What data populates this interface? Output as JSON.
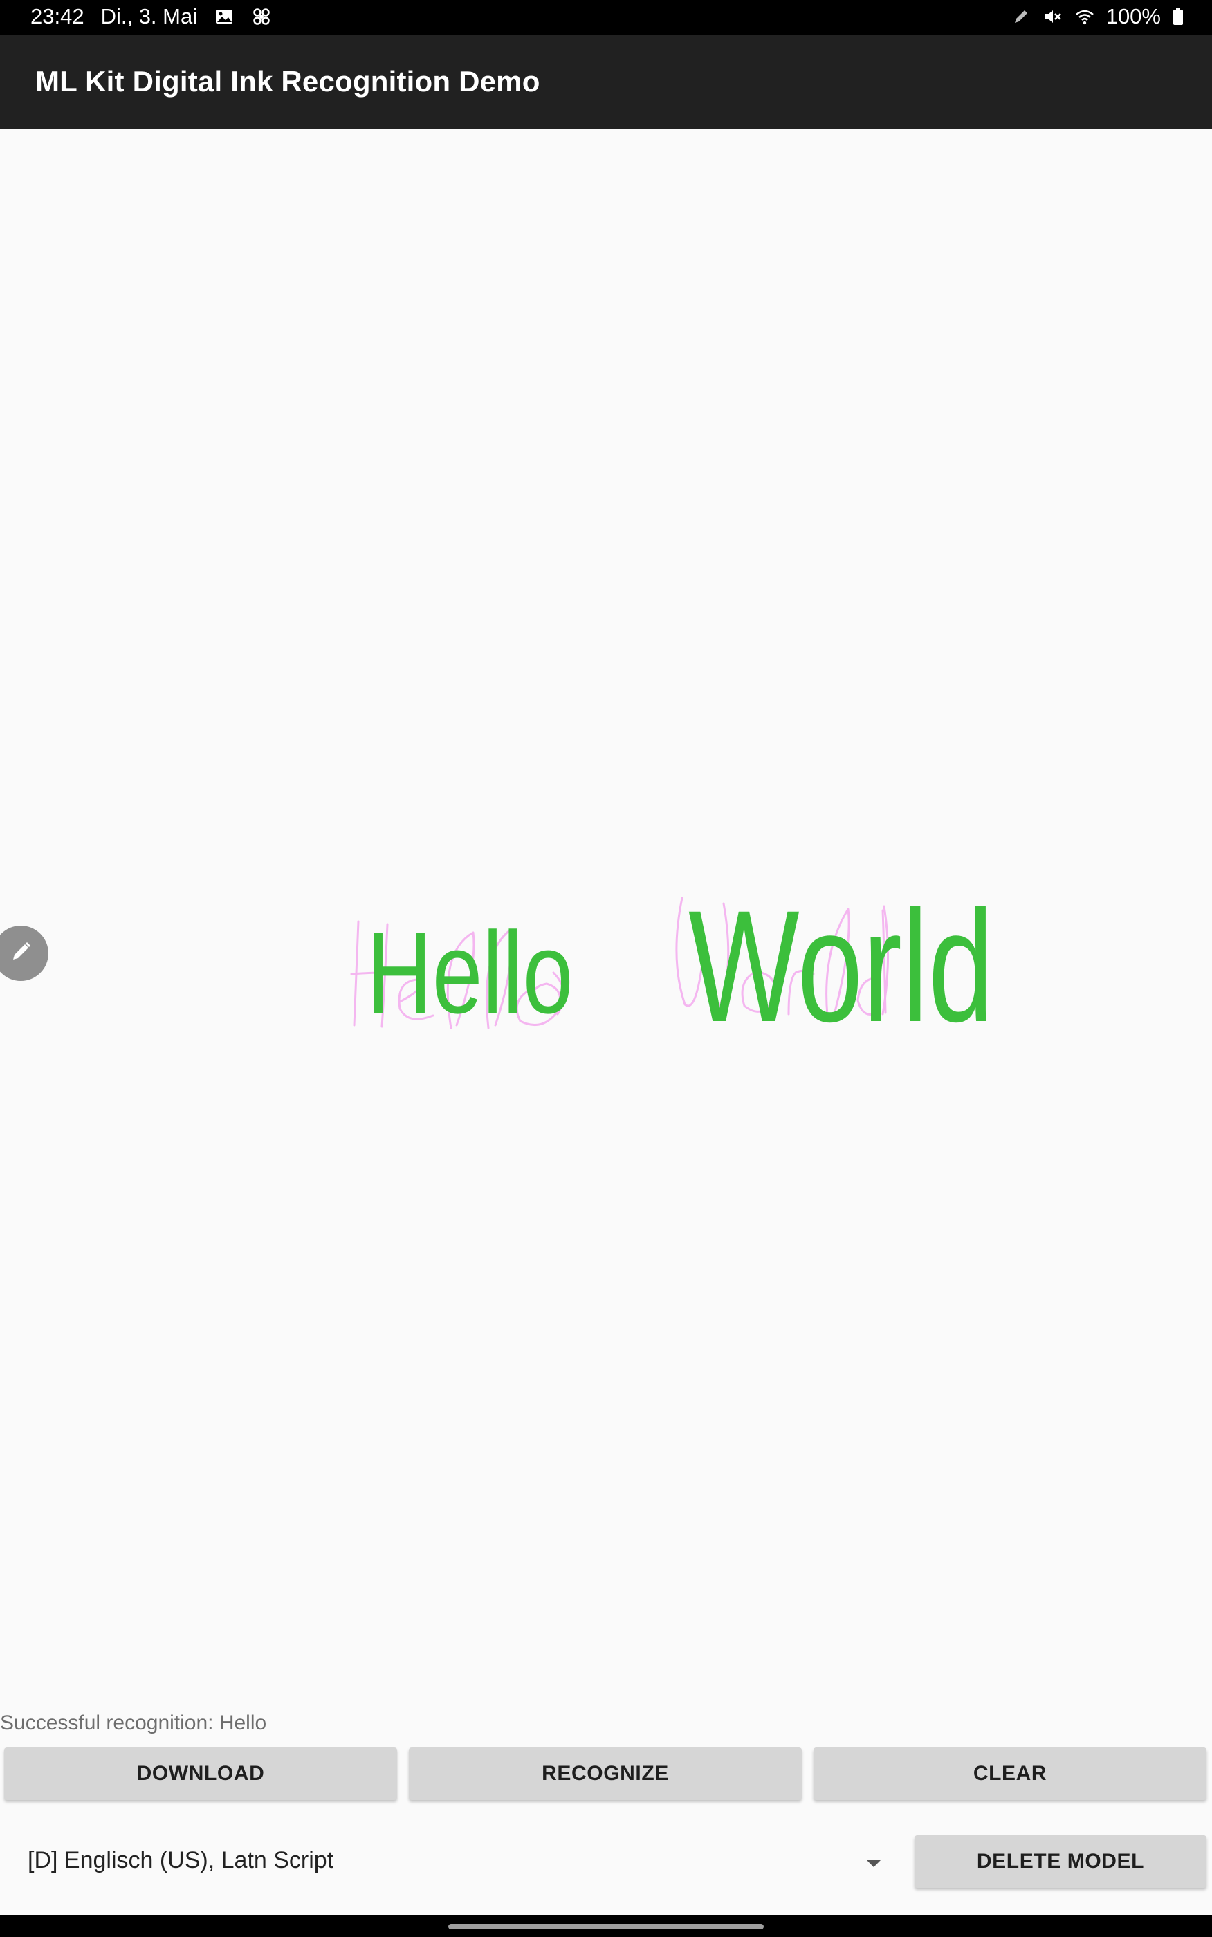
{
  "status_bar": {
    "time": "23:42",
    "date": "Di., 3. Mai",
    "left_icons": [
      "gallery-icon",
      "fan-icon"
    ],
    "right_icons": [
      "pen-icon",
      "mute-icon",
      "wifi-icon"
    ],
    "battery": "100%"
  },
  "app_bar": {
    "title": "ML Kit Digital Ink Recognition Demo"
  },
  "canvas": {
    "recognized_words": [
      "Hello",
      "World"
    ],
    "ink_color": "#f4b6f0",
    "text_color": "#3cbf3c",
    "fab_icon": "pencil-icon"
  },
  "status_text": "Successful recognition: Hello",
  "buttons": {
    "download": "DOWNLOAD",
    "recognize": "RECOGNIZE",
    "clear": "CLEAR",
    "delete_model": "DELETE MODEL"
  },
  "language_spinner": {
    "selected": "[D] Englisch (US), Latn Script",
    "icon": "dropdown-arrow-icon"
  }
}
